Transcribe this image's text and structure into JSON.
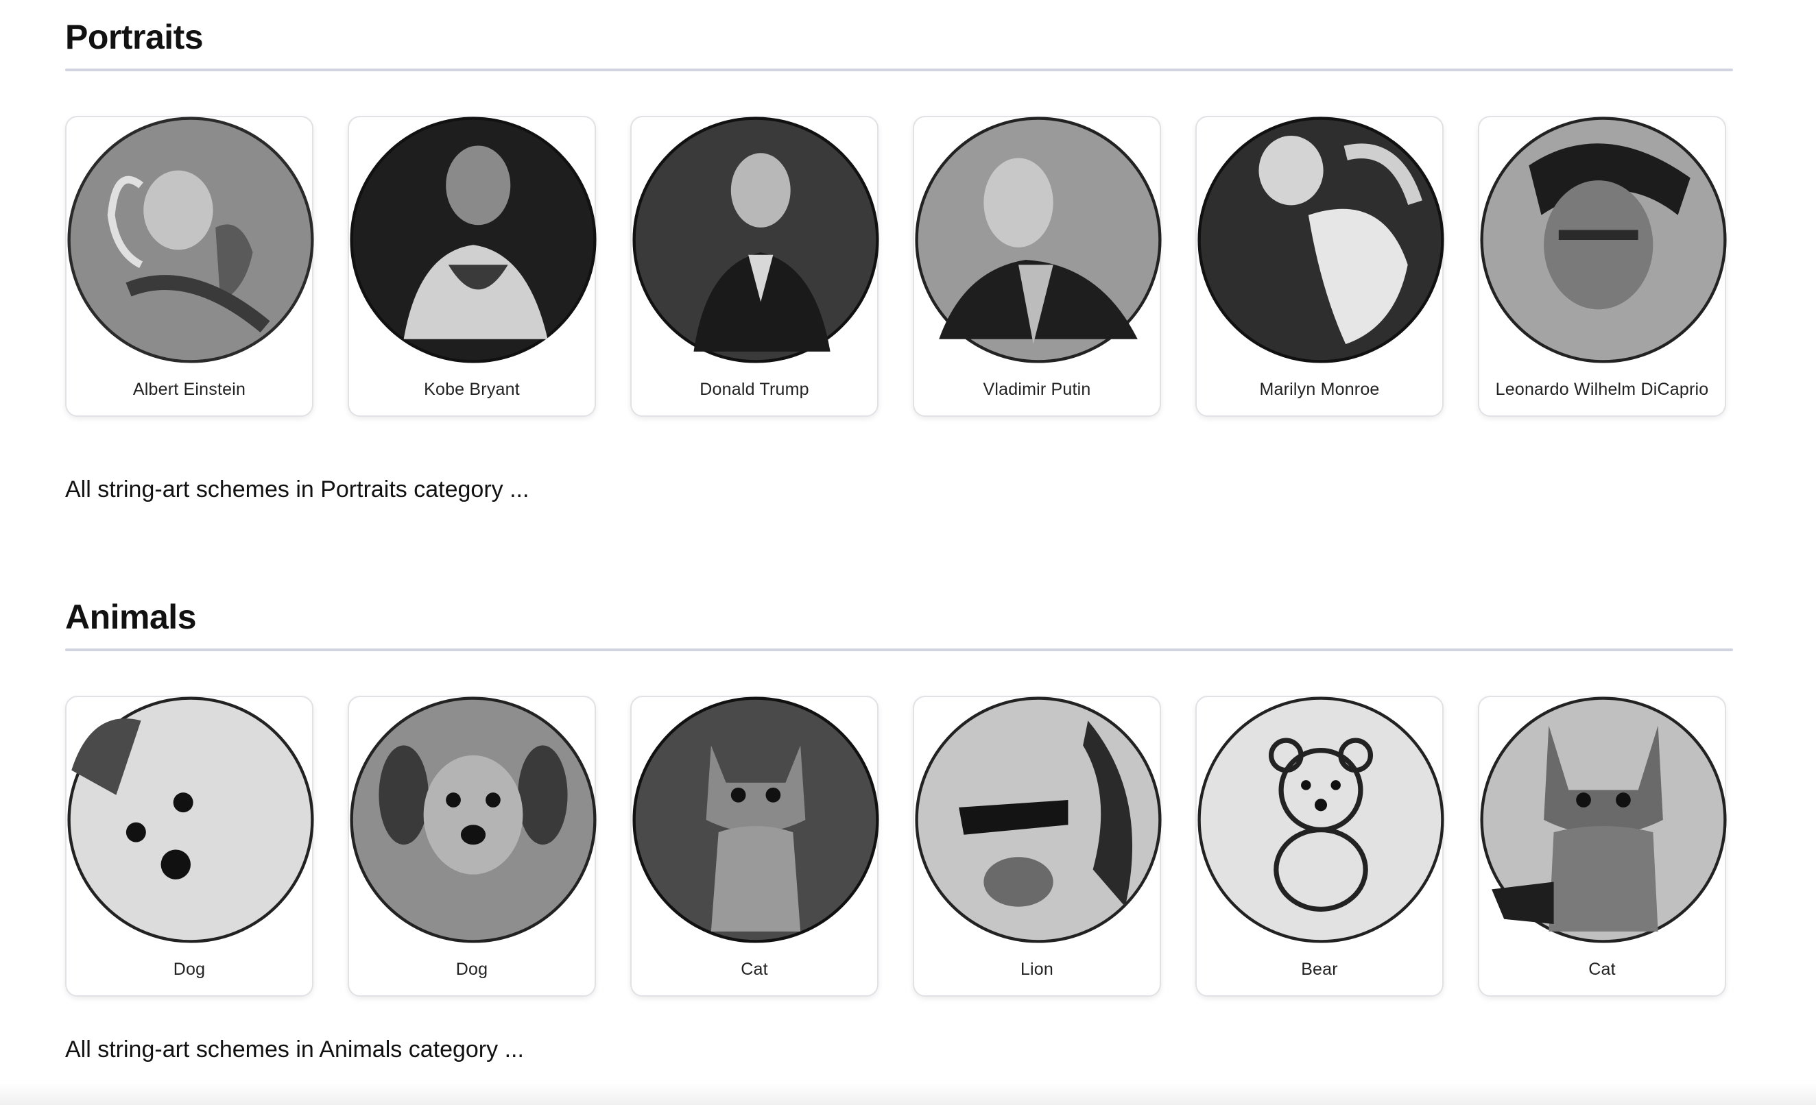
{
  "sections": [
    {
      "title": "Portraits",
      "items": [
        {
          "label": "Albert Einstein"
        },
        {
          "label": "Kobe Bryant"
        },
        {
          "label": "Donald Trump"
        },
        {
          "label": "Vladimir Putin"
        },
        {
          "label": "Marilyn Monroe"
        },
        {
          "label": "Leonardo Wilhelm DiCaprio"
        }
      ],
      "see_all": "All string-art schemes in Portraits category ..."
    },
    {
      "title": "Animals",
      "items": [
        {
          "label": "Dog"
        },
        {
          "label": "Dog"
        },
        {
          "label": "Cat"
        },
        {
          "label": "Lion"
        },
        {
          "label": "Bear"
        },
        {
          "label": "Cat"
        }
      ],
      "see_all": "All string-art schemes in Animals category ..."
    }
  ]
}
